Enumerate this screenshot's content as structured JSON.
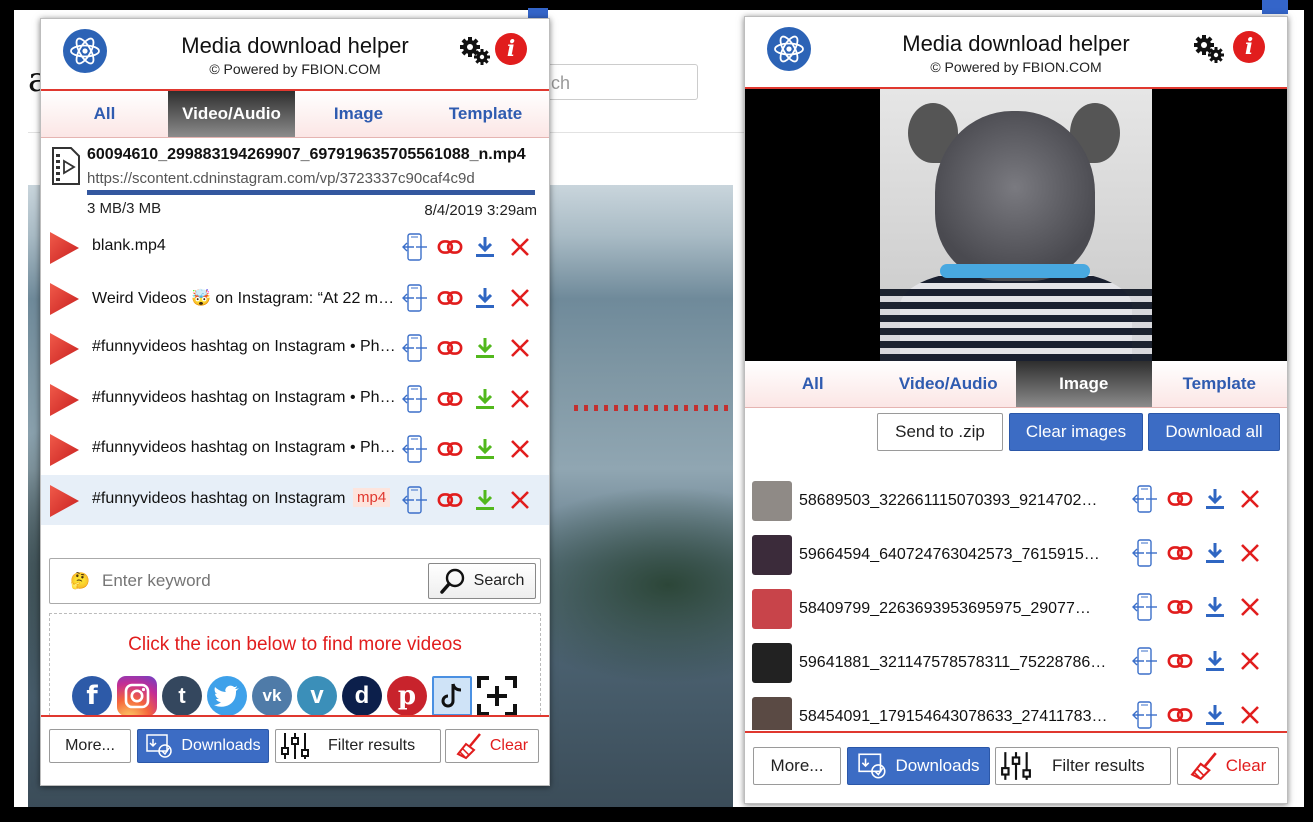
{
  "background": {
    "search_fragment": "ch",
    "logo_fragment": "ag"
  },
  "colors": {
    "accent": "#e0382f",
    "brand_blue": "#2c63b6",
    "tab_blue": "#2f5bb0",
    "download_blue": "#2f66c2",
    "download_green": "#52b81d"
  },
  "panel_left": {
    "title": "Media download helper",
    "subtitle": "© Powered by FBION.COM",
    "tabs": [
      {
        "label": "All",
        "active": false
      },
      {
        "label": "Video/Audio",
        "active": true
      },
      {
        "label": "Image",
        "active": false
      },
      {
        "label": "Template",
        "active": false
      }
    ],
    "current": {
      "name": "60094610_299883194269907_697919635705561088_n.mp4",
      "url": "https://scontent.cdninstagram.com/vp/3723337c90caf4c9d",
      "progress_pct": 100,
      "size": "3 MB/3 MB",
      "date": "8/4/2019 3:29am"
    },
    "rows": [
      {
        "name": "blank.mp4",
        "download_color": "blue",
        "badge": ""
      },
      {
        "name": "Weird Videos 🤯 on Instagram: “At 22 m…",
        "download_color": "blue",
        "badge": ""
      },
      {
        "name": "#funnyvideos hashtag on Instagram • Ph…",
        "download_color": "green",
        "badge": ""
      },
      {
        "name": "#funnyvideos hashtag on Instagram • Ph…",
        "download_color": "green",
        "badge": ""
      },
      {
        "name": "#funnyvideos hashtag on Instagram • Ph…",
        "download_color": "green",
        "badge": ""
      },
      {
        "name": "#funnyvideos hashtag on Instagram",
        "download_color": "green",
        "badge": "mp4"
      }
    ],
    "search": {
      "emoji": "🤔",
      "placeholder": "Enter keyword",
      "button": "Search"
    },
    "find_message": "Click the icon below to find more videos",
    "social_icons": [
      "facebook-icon",
      "instagram-icon",
      "tumblr-icon",
      "twitter-icon",
      "vk-icon",
      "vimeo-icon",
      "dailymotion-icon",
      "pinterest-icon",
      "tiktok-icon",
      "add-site-icon"
    ],
    "footer": {
      "more": "More...",
      "downloads": "Downloads",
      "filter": "Filter results",
      "clear": "Clear"
    }
  },
  "panel_right": {
    "title": "Media download helper",
    "subtitle": "© Powered by FBION.COM",
    "tabs": [
      {
        "label": "All",
        "active": false
      },
      {
        "label": "Video/Audio",
        "active": false
      },
      {
        "label": "Image",
        "active": true
      },
      {
        "label": "Template",
        "active": false
      }
    ],
    "toolbar": {
      "zip": "Send to .zip",
      "clear_images": "Clear images",
      "download_all": "Download all"
    },
    "items": [
      {
        "name": "58689503_322661115070393_9214702…",
        "thumb": "#8f8a86"
      },
      {
        "name": "59664594_640724763042573_7615915…",
        "thumb": "#3b2b3a"
      },
      {
        "name": "58409799_2263693953695975_29077…",
        "thumb": "#c8444a"
      },
      {
        "name": "59641881_321147578578311_75228786…",
        "thumb": "#222222"
      },
      {
        "name": "58454091_179154643078633_27411783…",
        "thumb": "#5a4a44"
      }
    ],
    "footer": {
      "more": "More...",
      "downloads": "Downloads",
      "filter": "Filter results",
      "clear": "Clear"
    }
  }
}
